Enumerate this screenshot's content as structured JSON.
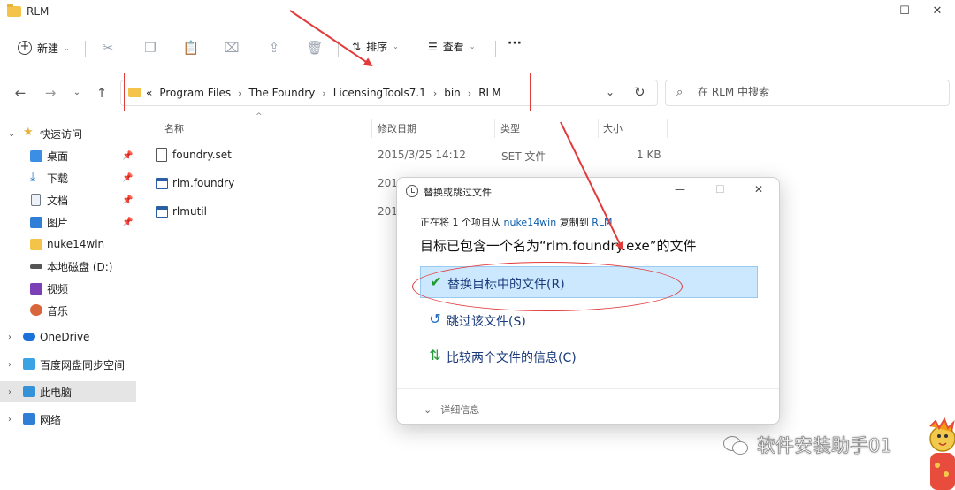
{
  "window": {
    "title": "RLM",
    "controls": [
      "minimize",
      "maximize",
      "close"
    ]
  },
  "toolbar": {
    "new_label": "新建",
    "sort_label": "排序",
    "view_label": "查看",
    "more_label": "···",
    "icons": [
      "cut-icon",
      "copy-icon",
      "paste-icon",
      "rename-icon",
      "share-icon",
      "delete-icon"
    ]
  },
  "address": {
    "prefix": "«",
    "crumbs": [
      "Program Files",
      "The Foundry",
      "LicensingTools7.1",
      "bin",
      "RLM"
    ],
    "search_placeholder": "在 RLM 中搜索"
  },
  "sidebar": {
    "items": [
      {
        "label": "快速访问",
        "icon": "star-icon",
        "pinned": false
      },
      {
        "label": "桌面",
        "icon": "desktop-icon",
        "pinned": true
      },
      {
        "label": "下载",
        "icon": "download-icon",
        "pinned": true
      },
      {
        "label": "文档",
        "icon": "document-icon",
        "pinned": true
      },
      {
        "label": "图片",
        "icon": "pictures-icon",
        "pinned": true
      },
      {
        "label": "nuke14win",
        "icon": "folder-icon",
        "pinned": false
      },
      {
        "label": "本地磁盘 (D:)",
        "icon": "drive-icon",
        "pinned": false
      },
      {
        "label": "视频",
        "icon": "video-icon",
        "pinned": false
      },
      {
        "label": "音乐",
        "icon": "music-icon",
        "pinned": false
      },
      {
        "label": "OneDrive",
        "icon": "cloud-icon",
        "pinned": false
      },
      {
        "label": "百度网盘同步空间",
        "icon": "baidu-icon",
        "pinned": false
      },
      {
        "label": "此电脑",
        "icon": "computer-icon",
        "pinned": false
      },
      {
        "label": "网络",
        "icon": "network-icon",
        "pinned": false
      }
    ]
  },
  "filelist": {
    "columns": [
      "名称",
      "修改日期",
      "类型",
      "大小"
    ],
    "rows": [
      {
        "name": "foundry.set",
        "date": "2015/3/25 14:12",
        "type": "SET 文件",
        "size": "1 KB"
      },
      {
        "name": "rlm.foundry",
        "date": "201",
        "type": "",
        "size": ""
      },
      {
        "name": "rlmutil",
        "date": "201",
        "type": "",
        "size": ""
      }
    ]
  },
  "dialog": {
    "title": "替换或跳过文件",
    "line_prefix": "正在将 1 个项目从 ",
    "source": "nuke14win",
    "line_mid": " 复制到 ",
    "destination": "RLM",
    "heading": "目标已包含一个名为“rlm.foundry.exe”的文件",
    "options": [
      {
        "label": "替换目标中的文件(R)",
        "icon": "checkmark-icon"
      },
      {
        "label": "跳过该文件(S)",
        "icon": "skip-arrow-icon"
      },
      {
        "label": "比较两个文件的信息(C)",
        "icon": "compare-icon"
      }
    ],
    "details_label": "详细信息"
  },
  "watermark": {
    "text": "软件安装助手01"
  },
  "colors": {
    "annotation_red": "#e23b3b",
    "selected_option_bg": "#cce8ff",
    "link_blue": "#0b5cad",
    "folder_yellow": "#f3c34a"
  }
}
